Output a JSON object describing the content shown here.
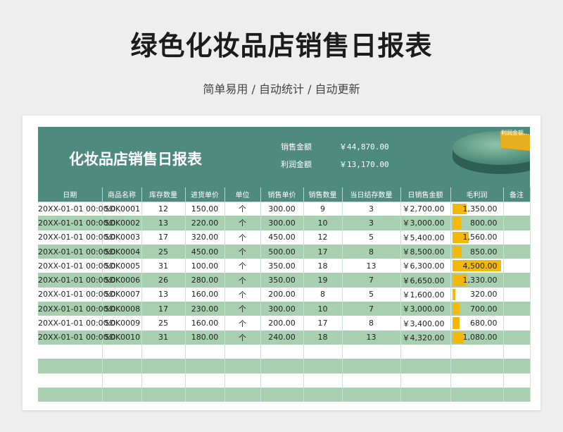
{
  "header": {
    "title": "绿色化妆品店销售日报表",
    "subtitle": "简单易用 / 自动统计 / 自动更新"
  },
  "banner": {
    "title": "化妆品店销售日报表",
    "sales_label": "销售金额",
    "sales_value": "￥44,870.00",
    "profit_label": "利润金额",
    "profit_value": "￥13,170.00",
    "pie_label": "利润金额…",
    "pie_profit_fraction": 0.2935
  },
  "colors": {
    "banner": "#4f8a7e",
    "row_alt": "#a8cfb0",
    "bar": "#f4b80a"
  },
  "table": {
    "columns": [
      "日期",
      "商品名称",
      "库存数量",
      "进货单价",
      "单位",
      "销售单价",
      "销售数量",
      "当日结存数量",
      "日销售金额",
      "毛利润",
      "备注"
    ],
    "rows": [
      {
        "date": "20XX-01-01 00:00:0",
        "code": "SDK0001",
        "stock": "12",
        "cost": "150.00",
        "unit": "个",
        "price": "300.00",
        "qty": "9",
        "remain": "3",
        "amount": "￥2,700.00",
        "profit": "1,350.00",
        "note": ""
      },
      {
        "date": "20XX-01-01 00:00:0",
        "code": "SDK0002",
        "stock": "13",
        "cost": "220.00",
        "unit": "个",
        "price": "300.00",
        "qty": "10",
        "remain": "3",
        "amount": "￥3,000.00",
        "profit": "800.00",
        "note": ""
      },
      {
        "date": "20XX-01-01 00:00:0",
        "code": "SDK0003",
        "stock": "17",
        "cost": "320.00",
        "unit": "个",
        "price": "450.00",
        "qty": "12",
        "remain": "5",
        "amount": "￥5,400.00",
        "profit": "1,560.00",
        "note": ""
      },
      {
        "date": "20XX-01-01 00:00:0",
        "code": "SDK0004",
        "stock": "25",
        "cost": "450.00",
        "unit": "个",
        "price": "500.00",
        "qty": "17",
        "remain": "8",
        "amount": "￥8,500.00",
        "profit": "850.00",
        "note": ""
      },
      {
        "date": "20XX-01-01 00:00:0",
        "code": "SDK0005",
        "stock": "31",
        "cost": "100.00",
        "unit": "个",
        "price": "350.00",
        "qty": "18",
        "remain": "13",
        "amount": "￥6,300.00",
        "profit": "4,500.00",
        "note": ""
      },
      {
        "date": "20XX-01-01 00:00:0",
        "code": "SDK0006",
        "stock": "26",
        "cost": "280.00",
        "unit": "个",
        "price": "350.00",
        "qty": "19",
        "remain": "7",
        "amount": "￥6,650.00",
        "profit": "1,330.00",
        "note": ""
      },
      {
        "date": "20XX-01-01 00:00:0",
        "code": "SDK0007",
        "stock": "13",
        "cost": "160.00",
        "unit": "个",
        "price": "200.00",
        "qty": "8",
        "remain": "5",
        "amount": "￥1,600.00",
        "profit": "320.00",
        "note": ""
      },
      {
        "date": "20XX-01-01 00:00:0",
        "code": "SDK0008",
        "stock": "17",
        "cost": "230.00",
        "unit": "个",
        "price": "300.00",
        "qty": "10",
        "remain": "7",
        "amount": "￥3,000.00",
        "profit": "700.00",
        "note": ""
      },
      {
        "date": "20XX-01-01 00:00:0",
        "code": "SDK0009",
        "stock": "25",
        "cost": "160.00",
        "unit": "个",
        "price": "200.00",
        "qty": "17",
        "remain": "8",
        "amount": "￥3,400.00",
        "profit": "680.00",
        "note": ""
      },
      {
        "date": "20XX-01-01 00:00:0",
        "code": "SDK0010",
        "stock": "31",
        "cost": "180.00",
        "unit": "个",
        "price": "240.00",
        "qty": "18",
        "remain": "13",
        "amount": "￥4,320.00",
        "profit": "1,080.00",
        "note": ""
      },
      {
        "date": "",
        "code": "",
        "stock": "",
        "cost": "",
        "unit": "",
        "price": "",
        "qty": "",
        "remain": "",
        "amount": "",
        "profit": "",
        "note": ""
      },
      {
        "date": "",
        "code": "",
        "stock": "",
        "cost": "",
        "unit": "",
        "price": "",
        "qty": "",
        "remain": "",
        "amount": "",
        "profit": "",
        "note": ""
      },
      {
        "date": "",
        "code": "",
        "stock": "",
        "cost": "",
        "unit": "",
        "price": "",
        "qty": "",
        "remain": "",
        "amount": "",
        "profit": "",
        "note": ""
      },
      {
        "date": "",
        "code": "",
        "stock": "",
        "cost": "",
        "unit": "",
        "price": "",
        "qty": "",
        "remain": "",
        "amount": "",
        "profit": "",
        "note": ""
      }
    ]
  }
}
